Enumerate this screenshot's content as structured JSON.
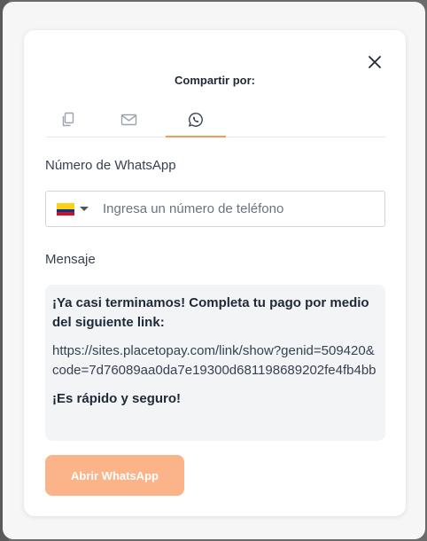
{
  "dialog": {
    "share_title": "Compartir por:",
    "close_icon": "close-icon"
  },
  "tabs": [
    {
      "icon": "copy-icon",
      "active": false
    },
    {
      "icon": "mail-icon",
      "active": false
    },
    {
      "icon": "whatsapp-icon",
      "active": true
    }
  ],
  "phone": {
    "label": "Número de WhatsApp",
    "country_flag": "colombia-flag-icon",
    "placeholder": "Ingresa un número de teléfono"
  },
  "message": {
    "label": "Mensaje",
    "intro": "¡Ya casi terminamos! Completa tu pago por medio del siguiente link:",
    "link": "https://sites.placetopay.com/link/show?genid=509420&code=7d76089aa0da7e19300d681198689202fe4fb4bb",
    "closing": "¡Es rápido y seguro!"
  },
  "actions": {
    "open_whatsapp": "Abrir WhatsApp"
  },
  "colors": {
    "accent": "#f29b5c",
    "button_disabled": "#fbb38a",
    "message_bg": "#f3f4f6"
  }
}
